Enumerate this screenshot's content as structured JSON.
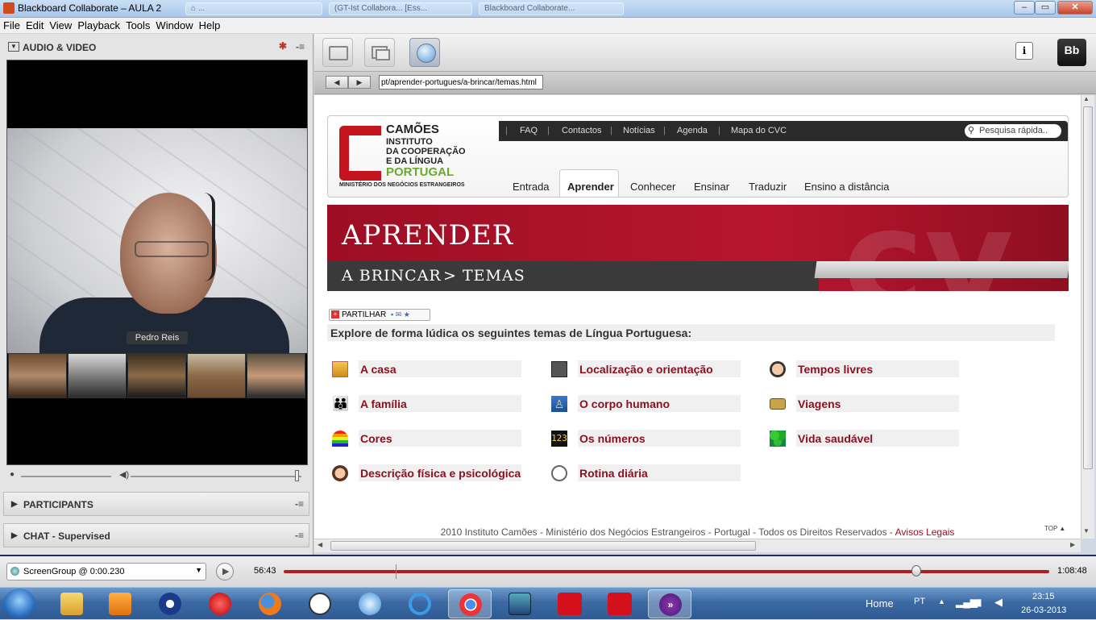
{
  "window": {
    "title": "Blackboard Collaborate – AULA 2",
    "bg_tabs": [
      "⌂ ...",
      "(GT-Ist Collabora... [Ess...",
      "Blackboard Collaborate..."
    ],
    "controls": {
      "minimize": "–",
      "maximize": "▭",
      "close": "✕"
    }
  },
  "menu": [
    "File",
    "Edit",
    "View",
    "Playback",
    "Tools",
    "Window",
    "Help"
  ],
  "left": {
    "av_title": "AUDIO & VIDEO",
    "speaker_name": "Pedro Reis",
    "participants_title": "PARTICIPANTS",
    "chat_title": "CHAT - Supervised",
    "options_glyph": "-≡"
  },
  "browser": {
    "url": "pt/aprender-portugues/a-brincar/temas.html",
    "back": "◀",
    "forward": "▶"
  },
  "site": {
    "logo_lines": [
      "CAMÕES",
      "INSTITUTO",
      "DA COOPERAÇÃO",
      "E DA LÍNGUA"
    ],
    "logo_country": "PORTUGAL",
    "logo_ministry": "MINISTÉRIO DOS NEGÓCIOS ESTRANGEIROS",
    "top_links": [
      "FAQ",
      "Contactos",
      "Notícias",
      "Agenda",
      "Mapa do CVC"
    ],
    "search_placeholder": "Pesquisa rápida..",
    "main_nav": [
      "Entrada",
      "Aprender",
      "Conhecer",
      "Ensinar",
      "Traduzir",
      "Ensino a distância"
    ],
    "active_nav": "Aprender",
    "banner_title": "APRENDER",
    "crumb_1": "A BRINCAR",
    "crumb_sep": ">",
    "crumb_2": "TEMAS",
    "share_label": "PARTILHAR",
    "intro": "Explore de forma lúdica os seguintes temas de Língua Portuguesa:",
    "topics_col1": [
      "A casa",
      "A família",
      "Cores",
      "Descrição física e psicológica"
    ],
    "topics_col2": [
      "Localização e orientação",
      "O corpo humano",
      "Os números",
      "Rotina diária"
    ],
    "topics_col3": [
      "Tempos livres",
      "Viagens",
      "Vida saudável"
    ],
    "icons_col1": [
      "house-icon",
      "family-icon",
      "rainbow-icon",
      "face-icon"
    ],
    "icons_col2": [
      "map-icon",
      "body-icon",
      "numbers-icon",
      "clock-icon"
    ],
    "icons_col3": [
      "person-icon",
      "bus-icon",
      "clover-icon"
    ],
    "numbers_icon_text": "123",
    "footer_text": "2010 Instituto Camões - Ministério dos Negócios Estrangeiros - Portugal - Todos os Direitos Reservados - ",
    "footer_link": "Avisos Legais",
    "top_link": "TOP"
  },
  "playback": {
    "selector": "ScreenGroup @ 0:00.230",
    "position_label": "56:43",
    "position_fraction": 0.826,
    "duration_label": "1:08:48"
  },
  "taskbar": {
    "tray_home": "Home",
    "tray_lang": "PT",
    "time": "23:15",
    "date": "26-03-2013"
  },
  "colors": {
    "brand_red": "#9c0e24",
    "topic_red": "#8b1020",
    "timeline_red": "#b31d1d",
    "logo_green": "#6aaa2a"
  }
}
